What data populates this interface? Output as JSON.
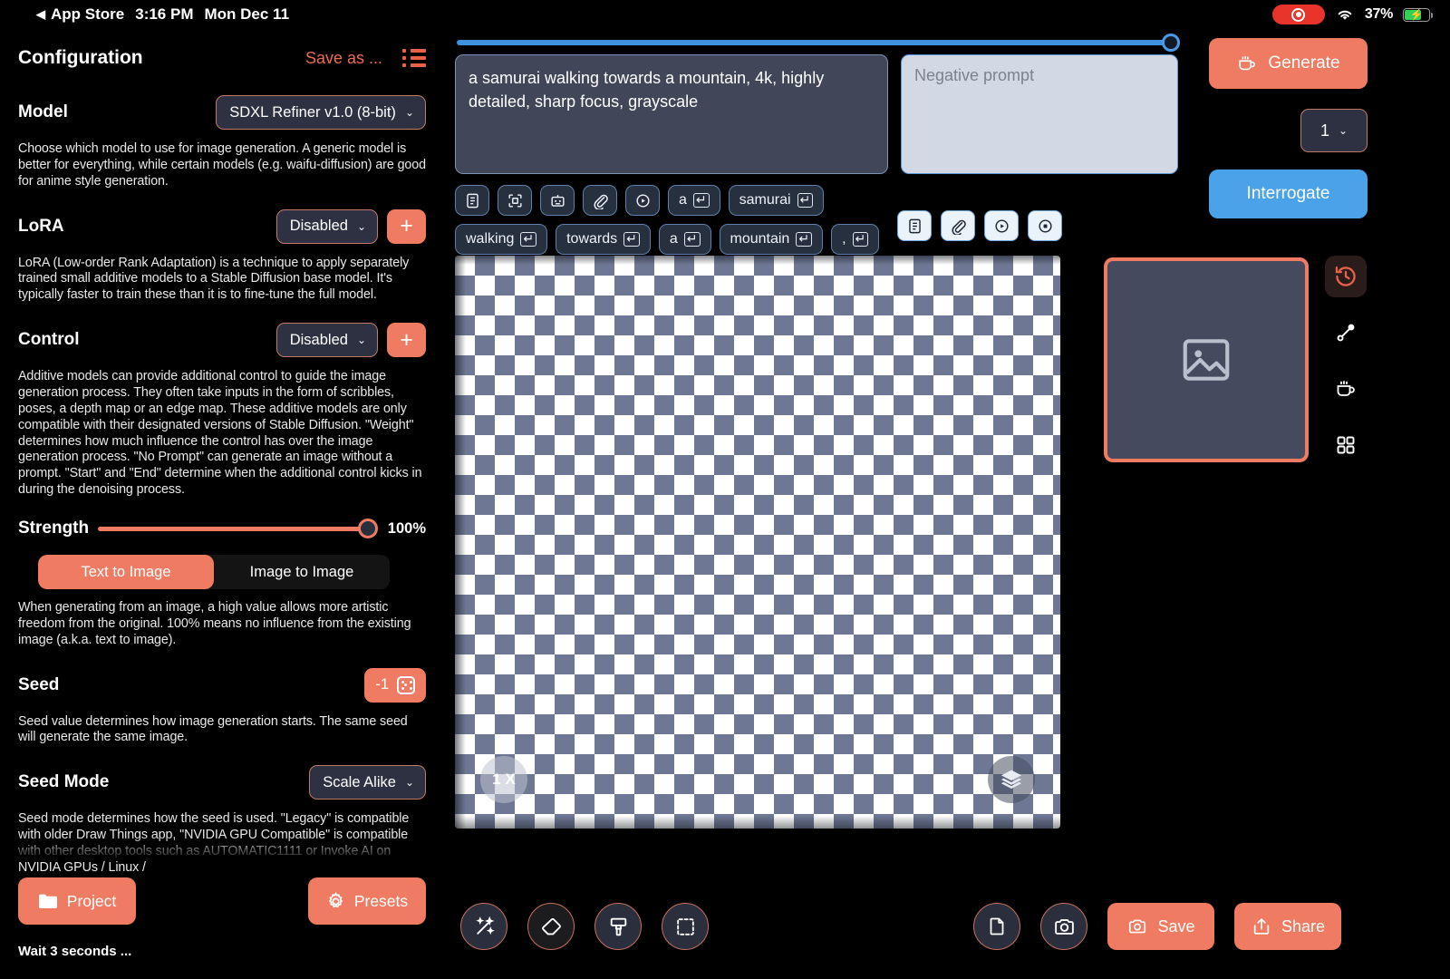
{
  "statusbar": {
    "back_label": "App Store",
    "back_arrow": "◀",
    "time": "3:16 PM",
    "date": "Mon Dec 11",
    "recording_icon": "record-icon",
    "wifi_icon": "wifi-icon",
    "battery_percent": "37%",
    "battery_charging": true
  },
  "sidebar": {
    "title": "Configuration",
    "save_as": "Save as ...",
    "list_icon": "list-icon",
    "model": {
      "label": "Model",
      "value": "SDXL Refiner v1.0 (8-bit)",
      "description": "Choose which model to use for image generation. A generic model is better for everything, while certain models (e.g. waifu-diffusion) are good for anime style generation."
    },
    "lora": {
      "label": "LoRA",
      "value": "Disabled",
      "add_label": "+",
      "description": "LoRA (Low-order Rank Adaptation) is a technique to apply separately trained small additive models to a Stable Diffusion base model. It's typically faster to train these than it is to fine-tune the full model."
    },
    "control": {
      "label": "Control",
      "value": "Disabled",
      "add_label": "+",
      "description": "Additive models can provide additional control to guide the image generation process. They often take inputs in the form of scribbles, poses, a depth map or an edge map. These additive models are only compatible with their designated versions of Stable Diffusion. \"Weight\" determines how much influence the control has over the image generation process. \"No Prompt\" can generate an image without a prompt. \"Start\" and \"End\" determine when the additional control kicks in during the denoising process."
    },
    "strength": {
      "label": "Strength",
      "value": "100%",
      "percent": 100
    },
    "mode_segment": {
      "options": [
        "Text to Image",
        "Image to Image"
      ],
      "selected": "Text to Image"
    },
    "mode_description": "When generating from an image, a high value allows more artistic freedom from the original. 100% means no influence from the existing image (a.k.a. text to image).",
    "seed": {
      "label": "Seed",
      "value": "-1",
      "dice_icon": "dice-icon",
      "description": "Seed value determines how image generation starts. The same seed will generate the same image."
    },
    "seed_mode": {
      "label": "Seed Mode",
      "value": "Scale Alike",
      "description": "Seed mode determines how the seed is used. \"Legacy\" is compatible with older Draw Things app, \"NVIDIA GPU Compatible\" is compatible with other desktop tools such as AUTOMATIC1111 or Invoke AI on NVIDIA GPUs / Linux /"
    },
    "buttons": {
      "project": "Project",
      "project_icon": "folder-icon",
      "presets": "Presets",
      "presets_icon": "gear-icon"
    },
    "status_text": "Wait 3 seconds ..."
  },
  "center": {
    "top_slider_percent": 100,
    "prompt": {
      "value": "a samurai walking towards a mountain, 4k, highly detailed, sharp focus, grayscale"
    },
    "negative_prompt": {
      "value": "",
      "placeholder": "Negative prompt"
    },
    "suggestion_bar": [
      {
        "type": "icon",
        "icon": "script-icon"
      },
      {
        "type": "icon",
        "icon": "crop-frame-icon"
      },
      {
        "type": "icon",
        "icon": "robot-icon"
      },
      {
        "type": "icon",
        "icon": "paperclip-icon"
      },
      {
        "type": "icon",
        "icon": "play-circle-icon"
      },
      {
        "type": "word",
        "label": "a"
      },
      {
        "type": "word",
        "label": "samurai"
      },
      {
        "type": "word",
        "label": "walking"
      },
      {
        "type": "word",
        "label": "towards"
      },
      {
        "type": "word",
        "label": "a"
      },
      {
        "type": "word",
        "label": "mountain"
      },
      {
        "type": "word",
        "label": ","
      }
    ],
    "negative_suggestion_bar": [
      {
        "icon": "script-icon"
      },
      {
        "icon": "paperclip-icon"
      },
      {
        "icon": "play-circle-icon"
      },
      {
        "icon": "stop-circle-icon"
      }
    ],
    "canvas": {
      "zoom_label": "1 X",
      "layers_icon": "layers-icon",
      "empty": true
    },
    "tools": [
      {
        "name": "magic-wand",
        "icon": "magic-wand-icon"
      },
      {
        "name": "eraser",
        "icon": "eraser-icon"
      },
      {
        "name": "paintbrush",
        "icon": "paintbrush-icon"
      },
      {
        "name": "marquee-select",
        "icon": "marquee-select-icon"
      }
    ]
  },
  "right": {
    "generate": {
      "label": "Generate",
      "icon": "coffee-cup-icon"
    },
    "image_count": "1",
    "interrogate": "Interrogate",
    "preview_thumbnail": {
      "icon": "image-placeholder-icon",
      "empty": true
    },
    "side_tools": [
      {
        "name": "history",
        "icon": "history-icon",
        "active": true
      },
      {
        "name": "path-edit",
        "icon": "node-path-icon",
        "active": false
      },
      {
        "name": "queue",
        "icon": "coffee-cup-icon",
        "active": false
      },
      {
        "name": "grid",
        "icon": "grid-icon",
        "active": false
      }
    ],
    "bottom_actions": [
      {
        "name": "new-page",
        "icon": "page-icon",
        "type": "circle"
      },
      {
        "name": "camera",
        "icon": "camera-icon",
        "type": "circle"
      },
      {
        "name": "save",
        "icon": "camera-icon",
        "label": "Save",
        "type": "pill"
      },
      {
        "name": "share",
        "icon": "share-icon",
        "label": "Share",
        "type": "pill"
      }
    ]
  },
  "colors": {
    "accent": "#ef7b62",
    "blue": "#4aa3e8",
    "panel": "#2d3142",
    "background": "#000000"
  }
}
